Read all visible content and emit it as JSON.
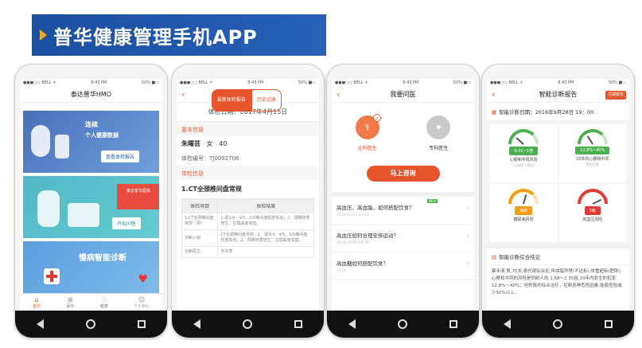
{
  "banner": {
    "title": "普华健康管理手机APP"
  },
  "status": {
    "carrier": "●●●○○ BELL ᯤ",
    "time": "8:43 PM",
    "battery": "50% ■▭"
  },
  "phone1": {
    "app_title": "泰达普华HMO",
    "card_a": {
      "head": "连续",
      "sub": "个人健康数据",
      "button": "查看体检报告"
    },
    "card_b": {
      "badge": "泰达普华医院",
      "button": "开始问医"
    },
    "card_c": {
      "head": "慢病智能诊断"
    },
    "tabs": [
      {
        "icon": "home-icon",
        "label": "首页"
      },
      {
        "icon": "grid-icon",
        "label": "服务"
      },
      {
        "icon": "heart-icon",
        "label": "健康"
      },
      {
        "icon": "user-icon",
        "label": "个人中心"
      }
    ]
  },
  "phone2": {
    "seg_on": "最新体检报告",
    "seg_off": "历史记录",
    "exam_date": "体检日期：2017年4月15日",
    "basic_info": "基本信息",
    "name": "朱曙芸",
    "gender": "女",
    "age": "40",
    "exam_no": "体检编号：TJ0092706",
    "exam_info": "体检信息",
    "section_title": "1.CT全颈椎间盘常规",
    "table_headers": [
      "体检项目",
      "体检结果"
    ],
    "rows": [
      {
        "item": "1.CT全颈椎间盘常规（颈）",
        "result": "1.颈3/4、4/5、5/6椎间盘轻度突出；2、颈椎骨质增生，生理曲度变直。"
      },
      {
        "item": "诊断小结",
        "result": "CT全颈椎间盘常规：1、颈3/4、4/5、5/6椎间盘轻度突出；2、颈椎骨质增生，生理曲度变直。"
      },
      {
        "item": "诊断医生",
        "result": "刘永寒"
      }
    ]
  },
  "phone3": {
    "app_title": "我要问医",
    "doctor_general": "全科医生",
    "doctor_special": "专科医生",
    "consult_button": "马上咨询",
    "new_tag": "NEW",
    "questions": [
      {
        "text": "高血压、高血脂，如何搭配饮食？",
        "meta": "2016-05-13 11:33",
        "count": "2"
      },
      {
        "text": "高血压如何合理安排运动？",
        "meta": "2016-05-09 08:09",
        "count": "2"
      },
      {
        "text": "高血糖如何搭配饮食？",
        "meta": "2016",
        "count": "5"
      }
    ]
  },
  "phone4": {
    "app_title": "智能诊断报告",
    "report_button": "往期报告",
    "diag_date": "智能诊断日期：2016年9月28日  19：00",
    "gauges": [
      {
        "color": "green",
        "value": "0.01~1倍",
        "label": "心梗和中风风险",
        "sub": "（与同龄人相比）",
        "level": 0.2
      },
      {
        "color": "green",
        "value": "12.8%~40%",
        "label": "10年内心梗和中风",
        "sub": "发生几率",
        "level": 0.3
      },
      {
        "color": "orange",
        "value": "偏高",
        "label": "糖尿病风险",
        "sub": "",
        "level": 0.6
      },
      {
        "color": "red",
        "value": "3级",
        "label": "高血压风险",
        "sub": "",
        "level": 0.9
      }
    ],
    "conclusion_title": "智能诊断综合结论",
    "conclusion_text": "蔡永清,男,75岁,患代谢综合征,伴血脂异常(不达标),体重超标(肥胖),心梗和中风的风险是同龄人的 1.68～2.35倍,10年内发生的机率12.8%～40%；但积极的综合治疗，控制各种危险因素,能使危险减少50%以上。"
  }
}
